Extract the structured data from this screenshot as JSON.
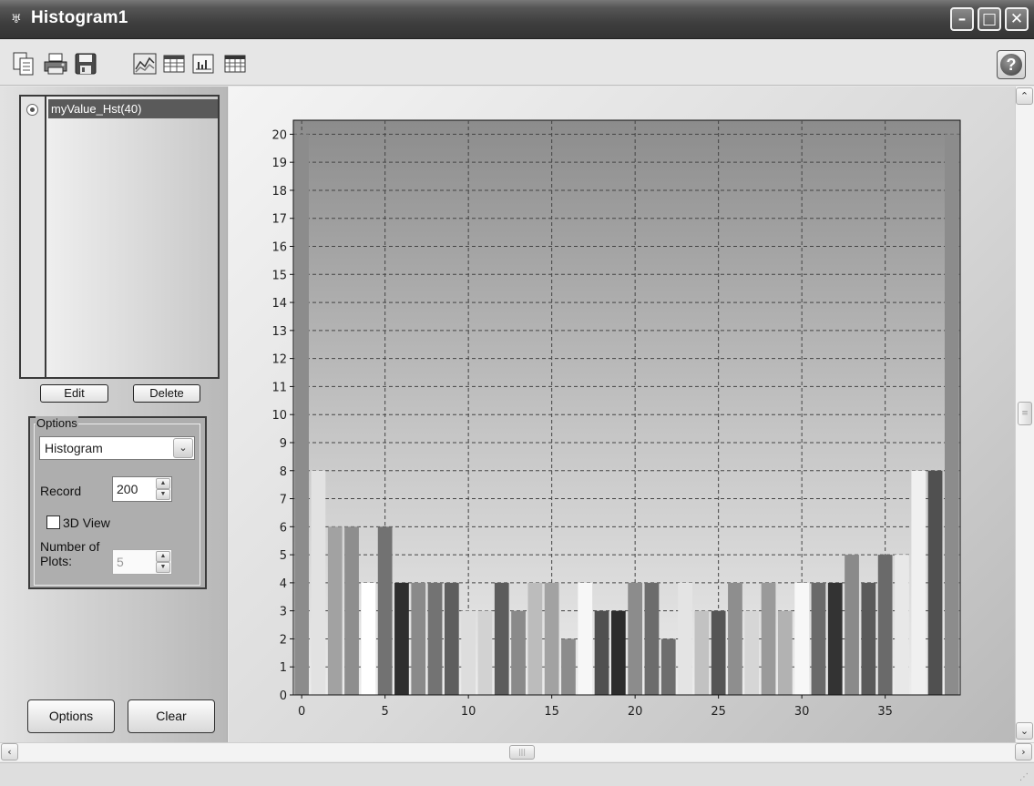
{
  "window": {
    "title": "Histogram1"
  },
  "toolbar": {
    "icons": [
      "copy-icon",
      "print-icon",
      "save-icon",
      "chart-icon",
      "table-icon",
      "plot-icon",
      "grid-icon"
    ],
    "help_label": "?"
  },
  "left_panel": {
    "list_items": [
      "myValue_Hst(40)"
    ],
    "edit_label": "Edit",
    "delete_label": "Delete",
    "options": {
      "legend": "Options",
      "mode_selected": "Histogram",
      "record_label": "Record",
      "record_value": "200",
      "view3d_label": "3D View",
      "view3d_checked": false,
      "plots_label_line1": "Number of",
      "plots_label_line2": "Plots:",
      "plots_value": "5"
    },
    "options_button": "Options",
    "clear_button": "Clear"
  },
  "chart_data": {
    "type": "bar",
    "title": "",
    "xlabel": "",
    "ylabel": "",
    "xlim": [
      -0.5,
      39.5
    ],
    "ylim": [
      0,
      20.5
    ],
    "grid": true,
    "x_ticks": [
      0,
      5,
      10,
      15,
      20,
      25,
      30,
      35
    ],
    "y_ticks": [
      0,
      1,
      2,
      3,
      4,
      5,
      6,
      7,
      8,
      9,
      10,
      11,
      12,
      13,
      14,
      15,
      16,
      17,
      18,
      19,
      20
    ],
    "categories": [
      0,
      1,
      2,
      3,
      4,
      5,
      6,
      7,
      8,
      9,
      10,
      11,
      12,
      13,
      14,
      15,
      16,
      17,
      18,
      19,
      20,
      21,
      22,
      23,
      24,
      25,
      26,
      27,
      28,
      29,
      30,
      31,
      32,
      33,
      34,
      35,
      36,
      37,
      38,
      39
    ],
    "values": [
      20,
      8,
      6,
      6,
      4,
      6,
      4,
      4,
      4,
      4,
      3,
      3,
      4,
      3,
      4,
      4,
      2,
      4,
      3,
      3,
      4,
      4,
      2,
      4,
      3,
      3,
      4,
      3,
      4,
      3,
      4,
      4,
      4,
      5,
      4,
      5,
      5,
      8,
      8,
      20
    ],
    "bar_colors": [
      "#8c8c8c",
      "#e2e2e2",
      "#a2a2a2",
      "#8e8e8e",
      "#ffffff",
      "#727272",
      "#2e2e2e",
      "#8a8a8a",
      "#737373",
      "#5e5e5e",
      "#dddddd",
      "#d2d2d2",
      "#5c5c5c",
      "#8a8a8a",
      "#bcbcbc",
      "#a2a2a2",
      "#8c8c8c",
      "#f7f7f7",
      "#505050",
      "#2c2c2c",
      "#8c8c8c",
      "#6c6c6c",
      "#6e6e6e",
      "#e4e4e4",
      "#c2c2c2",
      "#555555",
      "#8e8e8e",
      "#d6d6d6",
      "#9a9a9a",
      "#b2b2b2",
      "#f7f7f7",
      "#6a6a6a",
      "#333333",
      "#8a8a8a",
      "#5a5a5a",
      "#6a6a6a",
      "#e8e8e8",
      "#f0f0f0",
      "#505050",
      "#8c8c8c"
    ]
  }
}
